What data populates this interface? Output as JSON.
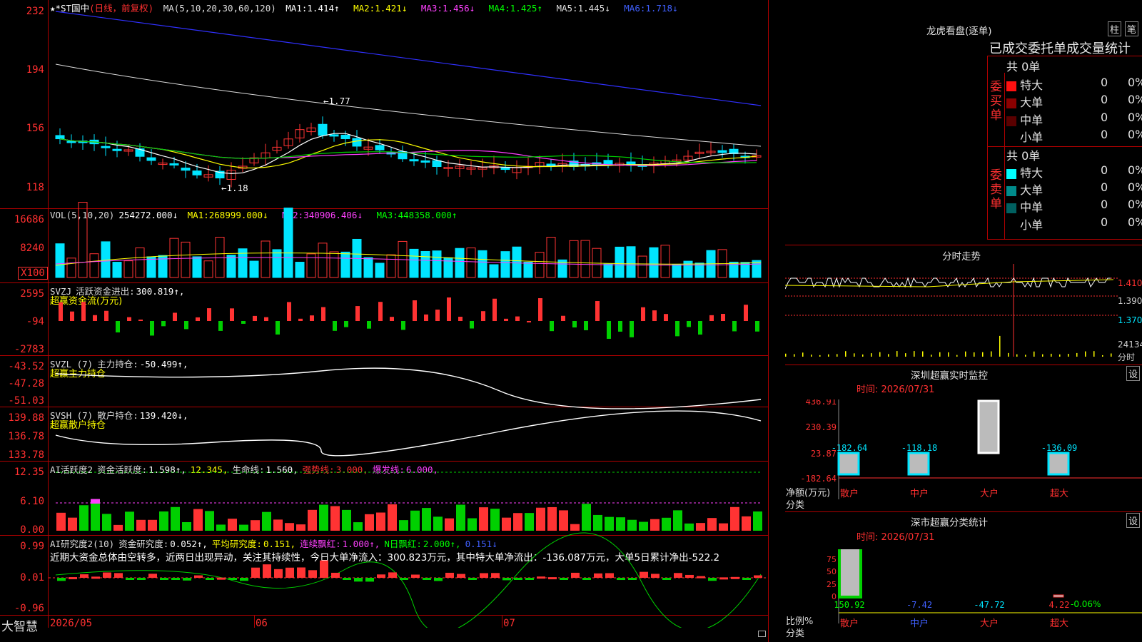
{
  "colors": {
    "up": "#ff3333",
    "down": "#00e5ff",
    "green": "#00d000",
    "yellow": "#ffff00",
    "magenta": "#ff40ff",
    "white": "#ffffff",
    "grid": "#b00000"
  },
  "main": {
    "stock": "★*ST国中",
    "period": "(日线，前复权)",
    "ma_header": "MA(5,10,20,30,60,120)",
    "ma": [
      {
        "l": "MA1:",
        "v": "1.414↑"
      },
      {
        "l": "MA2:",
        "v": "1.421↓"
      },
      {
        "l": "MA3:",
        "v": "1.456↓"
      },
      {
        "l": "MA4:",
        "v": "1.425↑"
      },
      {
        "l": "MA5:",
        "v": "1.445↓"
      },
      {
        "l": "MA6:",
        "v": "1.718↓"
      }
    ],
    "yticks": [
      "232",
      "194",
      "156",
      "118"
    ],
    "hi_label": "1.77",
    "lo_label": "1.18"
  },
  "vol": {
    "name": "VOL(5,10,20)",
    "value": "254272.000↓",
    "ma": [
      {
        "l": "MA1:",
        "v": "268999.000↓"
      },
      {
        "l": "MA2:",
        "v": "340906.406↓"
      },
      {
        "l": "MA3:",
        "v": "448358.000↑"
      }
    ],
    "yticks": [
      "16686",
      "8240"
    ],
    "unit": "X100"
  },
  "svzj": {
    "name": "SVZJ",
    "label": "活跃资金进出:",
    "value": "300.819↑,",
    "desc": "超赢资金流(万元)",
    "yticks": [
      "2595",
      "-94",
      "-2783"
    ]
  },
  "svzl": {
    "name": "SVZL (7)",
    "label": "主力持仓:",
    "value": "-50.499↑,",
    "desc": "超赢主力持仓",
    "yticks": [
      "-43.52",
      "-47.28",
      "-51.03"
    ]
  },
  "svsh": {
    "name": "SVSH (7)",
    "label": "散户持仓:",
    "value": "139.420↓,",
    "desc": "超赢散户持仓",
    "yticks": [
      "139.88",
      "136.78",
      "133.78"
    ]
  },
  "ai1": {
    "name": "AI活跃度2",
    "label": "资金活跃度:",
    "value": "1.598↑,",
    "v2": "12.345,",
    "life": "生命线:",
    "lifev": "1.560,",
    "strong": "强势线:",
    "strongv": "3.000,",
    "burst": "爆发线:",
    "burstv": "6.000,",
    "yticks": [
      "12.35",
      "6.10",
      "0.00"
    ]
  },
  "ai2": {
    "name": "AI研究度2(10)",
    "label": "资金研究度:",
    "value": "0.052↑,",
    "avg": "平均研究度:",
    "avgv": "0.151,",
    "cont": "连续飘红:",
    "contv": "1.000↑,",
    "ndays": "N日飘红:",
    "ndaysv": "2.000↑,",
    "last": "0.151↓",
    "comment": "近期大资金总体由空转多，近两日出现异动，关注其持续性，今日大单净流入：300.823万元，其中特大单净流出：-136.087万元，大单5日累计净出-522.2",
    "yticks": [
      "0.99",
      "0.01",
      "-0.96"
    ]
  },
  "xaxis": {
    "brand": "大智慧",
    "labels": [
      "2026/05",
      "06",
      "07"
    ]
  },
  "lhb": {
    "title": "龙虎看盘(逐单)",
    "btn1": "柱",
    "btn2": "笔",
    "header": "已成交委托单成交量统计",
    "buy": {
      "side": "委买单",
      "total": "共 0单",
      "rows": [
        {
          "name": "特大",
          "v": "0",
          "p": "0%"
        },
        {
          "name": "大单",
          "v": "0",
          "p": "0%"
        },
        {
          "name": "中单",
          "v": "0",
          "p": "0%"
        },
        {
          "name": "小单",
          "v": "0",
          "p": "0%"
        }
      ]
    },
    "sell": {
      "side": "委卖单",
      "total": "共 0单",
      "rows": [
        {
          "name": "特大",
          "v": "0",
          "p": "0%"
        },
        {
          "name": "大单",
          "v": "0",
          "p": "0%"
        },
        {
          "name": "中单",
          "v": "0",
          "p": "0%"
        },
        {
          "name": "小单",
          "v": "0",
          "p": "0%"
        }
      ]
    }
  },
  "fenshi": {
    "title": "分时走势",
    "yticks": [
      "1.410",
      "1.390",
      "1.370"
    ],
    "vol": "24134",
    "unit": "分时"
  },
  "monitor": {
    "title": "深圳超赢实时监控",
    "btn": "设",
    "time": "时间: 2026/07/31",
    "yticks": [
      "436.91",
      "230.39",
      "23.87",
      "-182.64"
    ],
    "ylabel": "净额(万元)",
    "xlabel": "分类",
    "bars": [
      {
        "cat": "散户",
        "v": -182.64,
        "label": "-182.64"
      },
      {
        "cat": "中户",
        "v": -118.18,
        "label": "-118.18"
      },
      {
        "cat": "大户",
        "v": 436.91,
        "label": "436.91"
      },
      {
        "cat": "超大",
        "v": -136.09,
        "label": "-136.09"
      }
    ]
  },
  "stats": {
    "title": "深市超赢分类统计",
    "btn": "设",
    "time": "时间: 2026/07/31",
    "yticks": [
      "75",
      "50",
      "25",
      "0"
    ],
    "ylabel": "比例%",
    "xlabel": "分类",
    "extra": "-0.06%",
    "bars": [
      {
        "cat": "散户",
        "label": "150.92",
        "v": 150.92
      },
      {
        "cat": "中户",
        "label": "-7.42",
        "v": -7.42
      },
      {
        "cat": "大户",
        "label": "-47.72",
        "v": -47.72
      },
      {
        "cat": "超大",
        "label": "4.22",
        "v": 4.22
      }
    ]
  }
}
